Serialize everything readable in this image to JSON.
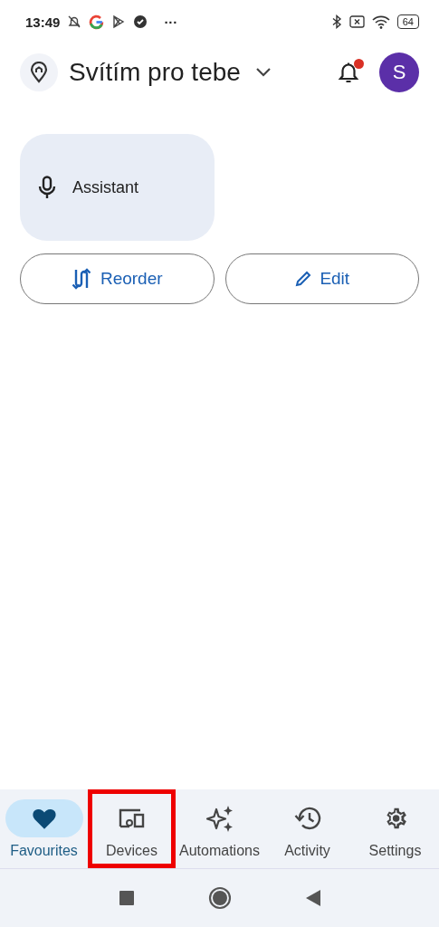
{
  "status_bar": {
    "time": "13:49",
    "more": "···",
    "battery": "64"
  },
  "header": {
    "title": "Svítím pro tebe",
    "notification_dot": true,
    "avatar": "S"
  },
  "tiles": [
    {
      "label": "Assistant"
    }
  ],
  "actions": [
    {
      "kind": "reorder",
      "label": "Reorder"
    },
    {
      "kind": "edit",
      "label": "Edit"
    }
  ],
  "bottom_nav": [
    {
      "kind": "favourites",
      "label": "Favourites",
      "selected": true,
      "highlighted": false
    },
    {
      "kind": "devices",
      "label": "Devices",
      "selected": false,
      "highlighted": true
    },
    {
      "kind": "automations",
      "label": "Automations",
      "selected": false,
      "highlighted": false
    },
    {
      "kind": "activity",
      "label": "Activity",
      "selected": false,
      "highlighted": false
    },
    {
      "kind": "settings",
      "label": "Settings",
      "selected": false,
      "highlighted": false
    }
  ]
}
